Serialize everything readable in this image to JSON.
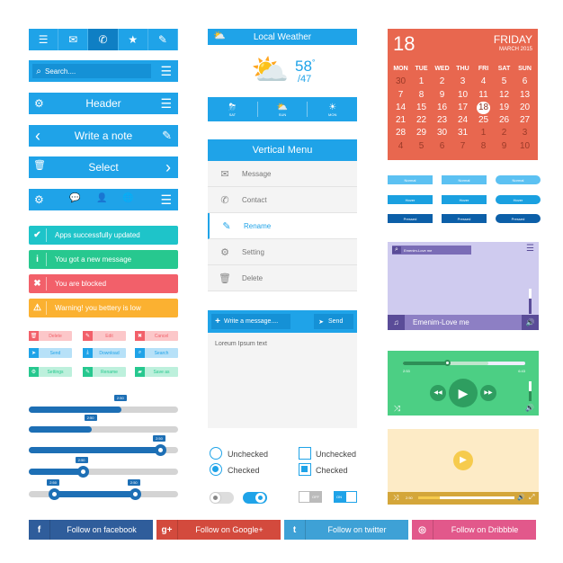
{
  "colors": {
    "primary": "#1fa3e8",
    "calendar": "#e8674f",
    "success": "#1ec4c9",
    "info": "#27c88f",
    "danger": "#f2606a",
    "warning": "#fbb131"
  },
  "tabbar": {
    "icons": [
      "menu-icon",
      "mail-icon",
      "phone-icon",
      "star-icon",
      "pencil-icon"
    ],
    "glyphs": [
      "☰",
      "✉",
      "✆",
      "★",
      "✎"
    ],
    "active": 2
  },
  "search": {
    "placeholder": "Search....",
    "icon": "⌕",
    "menu": "☰"
  },
  "header_bar": {
    "title": "Header",
    "left": "⚙",
    "right": "☰"
  },
  "note_bar": {
    "title": "Write a note",
    "left": "‹",
    "right": "✎"
  },
  "select_bar": {
    "title": "Select",
    "left": "🗑",
    "right": "›"
  },
  "icon_bar": {
    "glyphs": [
      "⚙",
      "💬",
      "👤",
      "🌐",
      "☰"
    ]
  },
  "alerts": [
    {
      "text": "Apps successfully updated",
      "icon": "✔",
      "color": "#1ec4c9"
    },
    {
      "text": "You got a new message",
      "icon": "i",
      "color": "#27c88f"
    },
    {
      "text": "You are blocked",
      "icon": "✖",
      "color": "#f2606a"
    },
    {
      "text": "Warning! you bettery is low",
      "icon": "⚠",
      "color": "#fbb131"
    }
  ],
  "small_buttons": [
    {
      "label": "Delete",
      "icon": "🗑",
      "color": "#f2606a",
      "bg": "#fcc7c9"
    },
    {
      "label": "Edit",
      "icon": "✎",
      "color": "#f2606a",
      "bg": "#fcc7c9"
    },
    {
      "label": "Cancel",
      "icon": "✖",
      "color": "#f2606a",
      "bg": "#fcc7c9"
    },
    {
      "label": "Send",
      "icon": "➤",
      "color": "#1fa3e8",
      "bg": "#b7e1f8"
    },
    {
      "label": "Download",
      "icon": "⤓",
      "color": "#1fa3e8",
      "bg": "#b7e1f8"
    },
    {
      "label": "Search",
      "icon": "⌕",
      "color": "#1fa3e8",
      "bg": "#b7e1f8"
    },
    {
      "label": "Settings",
      "icon": "⚙",
      "color": "#27c88f",
      "bg": "#bdf0dc"
    },
    {
      "label": "Rename",
      "icon": "✎",
      "color": "#27c88f",
      "bg": "#bdf0dc"
    },
    {
      "label": "Save as",
      "icon": "▰",
      "color": "#27c88f",
      "bg": "#bdf0dc"
    }
  ],
  "sliders": [
    {
      "value": 0.62,
      "label": "2:50",
      "knob": false
    },
    {
      "value": 0.42,
      "label": "2:50",
      "knob": false
    },
    {
      "value": 0.88,
      "label": "2:50",
      "knob": true
    },
    {
      "value": 0.36,
      "label": "2:50",
      "knob": true
    },
    {
      "range": [
        0.17,
        0.71
      ],
      "labels": [
        "2:50",
        "2:50"
      ]
    }
  ],
  "weather": {
    "title": "Local Weather",
    "temp": "58",
    "degree": "°",
    "low": "/47",
    "days": [
      {
        "label": "SAT",
        "icon": "⛈"
      },
      {
        "label": "SUN",
        "icon": "⛅"
      },
      {
        "label": "MON",
        "icon": "☀"
      }
    ]
  },
  "vertical_menu": {
    "title": "Vertical Menu",
    "active": 2,
    "items": [
      {
        "label": "Message",
        "icon": "✉"
      },
      {
        "label": "Contact",
        "icon": "✆"
      },
      {
        "label": "Rename",
        "icon": "✎"
      },
      {
        "label": "Setting",
        "icon": "⚙"
      },
      {
        "label": "Delete",
        "icon": "🗑"
      }
    ]
  },
  "composer": {
    "placeholder": "Write a message....",
    "send": "Send",
    "body": "Loreum Ipsum text"
  },
  "radios": [
    {
      "label": "Unchecked",
      "checked": false
    },
    {
      "label": "Checked",
      "checked": true
    }
  ],
  "checkboxes": [
    {
      "label": "Unchecked",
      "checked": false
    },
    {
      "label": "Checked",
      "checked": true
    }
  ],
  "toggles": {
    "off_label": "OFF",
    "on_label": "ON"
  },
  "calendar": {
    "day": "18",
    "weekday": "FRIDAY",
    "month_year": "MARCH 2015",
    "headers": [
      "MON",
      "TUE",
      "WED",
      "THU",
      "FRI",
      "SAT",
      "SUN"
    ],
    "days": [
      "30",
      "1",
      "2",
      "3",
      "4",
      "5",
      "6",
      "7",
      "8",
      "9",
      "10",
      "11",
      "12",
      "13",
      "14",
      "15",
      "16",
      "17",
      "18",
      "19",
      "20",
      "21",
      "22",
      "23",
      "24",
      "25",
      "26",
      "27",
      "28",
      "29",
      "30",
      "31",
      "1",
      "2",
      "3",
      "4",
      "5",
      "6",
      "7",
      "8",
      "9",
      "10"
    ],
    "selected": "18"
  },
  "state_buttons": {
    "rows": [
      {
        "label": "Normal",
        "color": "#5cc1f2"
      },
      {
        "label": "Hover",
        "color": "#1aa0e0"
      },
      {
        "label": "Pressed",
        "color": "#0c5fa8"
      }
    ]
  },
  "music_player": {
    "search": "Emenim-Love me",
    "track": "Emenim-Love me",
    "volume": 0.4
  },
  "audio_player": {
    "elapsed": "2:53",
    "total": "6:43",
    "progress": 0.36,
    "buffered": 0.7,
    "volume": 0.5
  },
  "video_player": {
    "elapsed": "2:50",
    "progress": 0.22
  },
  "social": [
    {
      "label": "Follow on facebook",
      "icon": "f",
      "color": "#2f5d9b"
    },
    {
      "label": "Follow on Google+",
      "icon": "g+",
      "color": "#d34a3d"
    },
    {
      "label": "Follow on twitter",
      "icon": "t",
      "color": "#3ea1d6"
    },
    {
      "label": "Follow on Dribbble",
      "icon": "◎",
      "color": "#e2588b"
    }
  ]
}
